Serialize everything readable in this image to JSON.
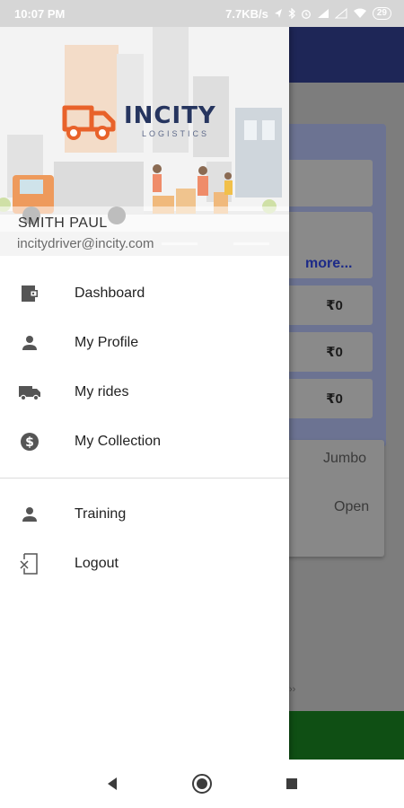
{
  "status_bar": {
    "time": "10:07 PM",
    "network_speed": "7.7KB/s",
    "battery": "29"
  },
  "drawer": {
    "logo": {
      "title": "INCITY",
      "subtitle": "LOGISTICS"
    },
    "user": {
      "name": "SMITH PAUL",
      "email": "incitydriver@incity.com"
    },
    "menu_primary": [
      {
        "label": "Dashboard",
        "icon": "wallet-icon"
      },
      {
        "label": "My Profile",
        "icon": "person-icon"
      },
      {
        "label": "My rides",
        "icon": "truck-icon"
      },
      {
        "label": "My Collection",
        "icon": "dollar-icon"
      }
    ],
    "menu_secondary": [
      {
        "label": "Training",
        "icon": "person-icon"
      },
      {
        "label": "Logout",
        "icon": "logout-icon"
      }
    ]
  },
  "background": {
    "more_link": "more...",
    "amounts": [
      "₹0",
      "₹0",
      "₹0"
    ],
    "vehicle_type": "Jumbo",
    "status": "Open",
    "chevron": "››"
  },
  "colors": {
    "header": "#1e2657",
    "footer": "#0f4f14",
    "logo_orange": "#e8622a",
    "logo_navy": "#26355f"
  }
}
